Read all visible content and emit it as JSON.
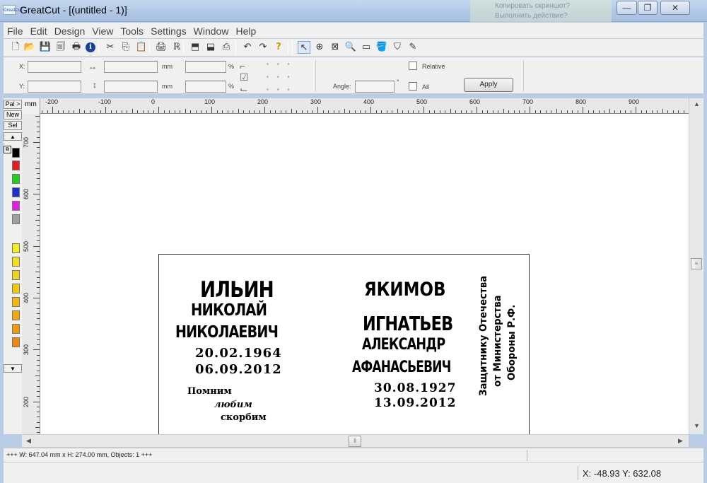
{
  "window": {
    "icon_text": "GreatCut",
    "title": "GreatCut",
    "document": " - [(untitled - 1)]",
    "background_text": "Копировать скриншот?\nВыполнить действие?",
    "minimize": "—",
    "maximize": "❐",
    "close": "✕"
  },
  "menu": {
    "items": [
      "File",
      "Edit",
      "Design",
      "View",
      "Tools",
      "Settings",
      "Window",
      "Help"
    ]
  },
  "toolbar": {
    "icons": [
      {
        "name": "new-document-icon",
        "glyph": "🗋"
      },
      {
        "name": "open-icon",
        "glyph": "📂"
      },
      {
        "name": "save-icon",
        "glyph": "💾"
      },
      {
        "name": "save-all-icon",
        "glyph": "🗐"
      },
      {
        "name": "preview-icon",
        "glyph": "🖶"
      },
      {
        "name": "info-icon",
        "glyph": "ℹ"
      },
      {
        "name": "cut-icon",
        "glyph": "✂"
      },
      {
        "name": "copy-icon",
        "glyph": "⎘"
      },
      {
        "name": "paste-icon",
        "glyph": "📋"
      },
      {
        "name": "print-icon",
        "glyph": "🖨"
      },
      {
        "name": "rename-icon",
        "glyph": "ℝ"
      },
      {
        "name": "import-icon",
        "glyph": "⬒"
      },
      {
        "name": "export-icon",
        "glyph": "⬓"
      },
      {
        "name": "plot-icon",
        "glyph": "⎙"
      },
      {
        "name": "undo-icon",
        "glyph": "↶"
      },
      {
        "name": "redo-icon",
        "glyph": "↷"
      },
      {
        "name": "help-icon",
        "glyph": "?"
      },
      {
        "name": "select-arrow-icon",
        "glyph": "↖"
      },
      {
        "name": "crosshair-icon",
        "glyph": "⊕"
      },
      {
        "name": "zoom-frame-icon",
        "glyph": "⊠"
      },
      {
        "name": "zoom-icon",
        "glyph": "🔍"
      },
      {
        "name": "measure-icon",
        "glyph": "▭"
      },
      {
        "name": "fill-icon",
        "glyph": "🪣"
      },
      {
        "name": "shield-icon",
        "glyph": "⛉"
      },
      {
        "name": "eyedropper-icon",
        "glyph": "✎"
      }
    ]
  },
  "properties": {
    "x_label": "X:",
    "y_label": "Y:",
    "unit_mm": "mm",
    "unit_percent": "%",
    "angle_label": "Angle:",
    "degree": "°",
    "relative_label": "Relative",
    "all_label": "All",
    "apply_label": "Apply",
    "x_value": "",
    "y_value": "",
    "w_value": "",
    "h_value": "",
    "angle_value": ""
  },
  "left_panel": {
    "pal_label": "Pal >",
    "new_label": "New",
    "sel_label": "Sel",
    "swatches": [
      "#000000",
      "#e02020",
      "#20d020",
      "#2030d0",
      "#e020e0",
      "#a0a0a0",
      "#ffffff",
      "#f0f020",
      "#f0e020",
      "#f0d020",
      "#f0c810",
      "#f0b810",
      "#f0a810",
      "#f09810",
      "#f08810"
    ]
  },
  "ruler": {
    "unit": "mm",
    "top_labels": [
      "-200",
      "-100",
      "0",
      "100",
      "200",
      "300",
      "400",
      "500",
      "600",
      "700",
      "800",
      "900"
    ],
    "left_labels": [
      "700",
      "600",
      "500",
      "400",
      "300",
      "200"
    ]
  },
  "design": {
    "left_block": {
      "surname": "ИЛЬИН",
      "name": "НИКОЛАЙ",
      "patronymic": "НИКОЛАЕВИЧ",
      "born": "20.02.1964",
      "died": "06.09.2012",
      "epitaph_1": "Помним",
      "epitaph_2": "любим",
      "epitaph_3": "скорбим"
    },
    "right_block": {
      "surname_top": "ЯКИМОВ",
      "surname": "ИГНАТЬЕВ",
      "name": "АЛЕКСАНДР",
      "patronymic": "АФАНАСЬЕВИЧ",
      "born": "30.08.1927",
      "died": "13.09.2012"
    },
    "vertical_text": {
      "line1": "Защитнику Отечества",
      "line2": "от Министерства",
      "line3": "Обороны Р.Ф."
    }
  },
  "status": {
    "objects": "+++ W: 647.04 mm x H: 274.00 mm, Objects: 1 +++",
    "coords": "X: -48.93 Y: 632.08"
  }
}
